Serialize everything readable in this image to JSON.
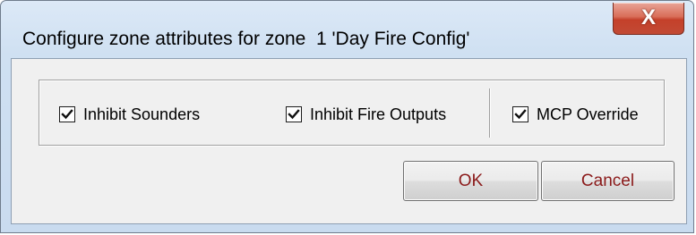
{
  "dialog": {
    "title": "Configure zone attributes for zone  1 'Day Fire Config'",
    "close_glyph": "X"
  },
  "options": [
    {
      "label": "Inhibit Sounders",
      "checked": true
    },
    {
      "label": "Inhibit Fire Outputs",
      "checked": true
    },
    {
      "label": "MCP Override",
      "checked": true
    }
  ],
  "buttons": {
    "ok_label": "OK",
    "cancel_label": "Cancel"
  },
  "colors": {
    "button_text": "#8b1a1a",
    "close_button": "#c4402a",
    "frame": "#cfe0f2"
  }
}
